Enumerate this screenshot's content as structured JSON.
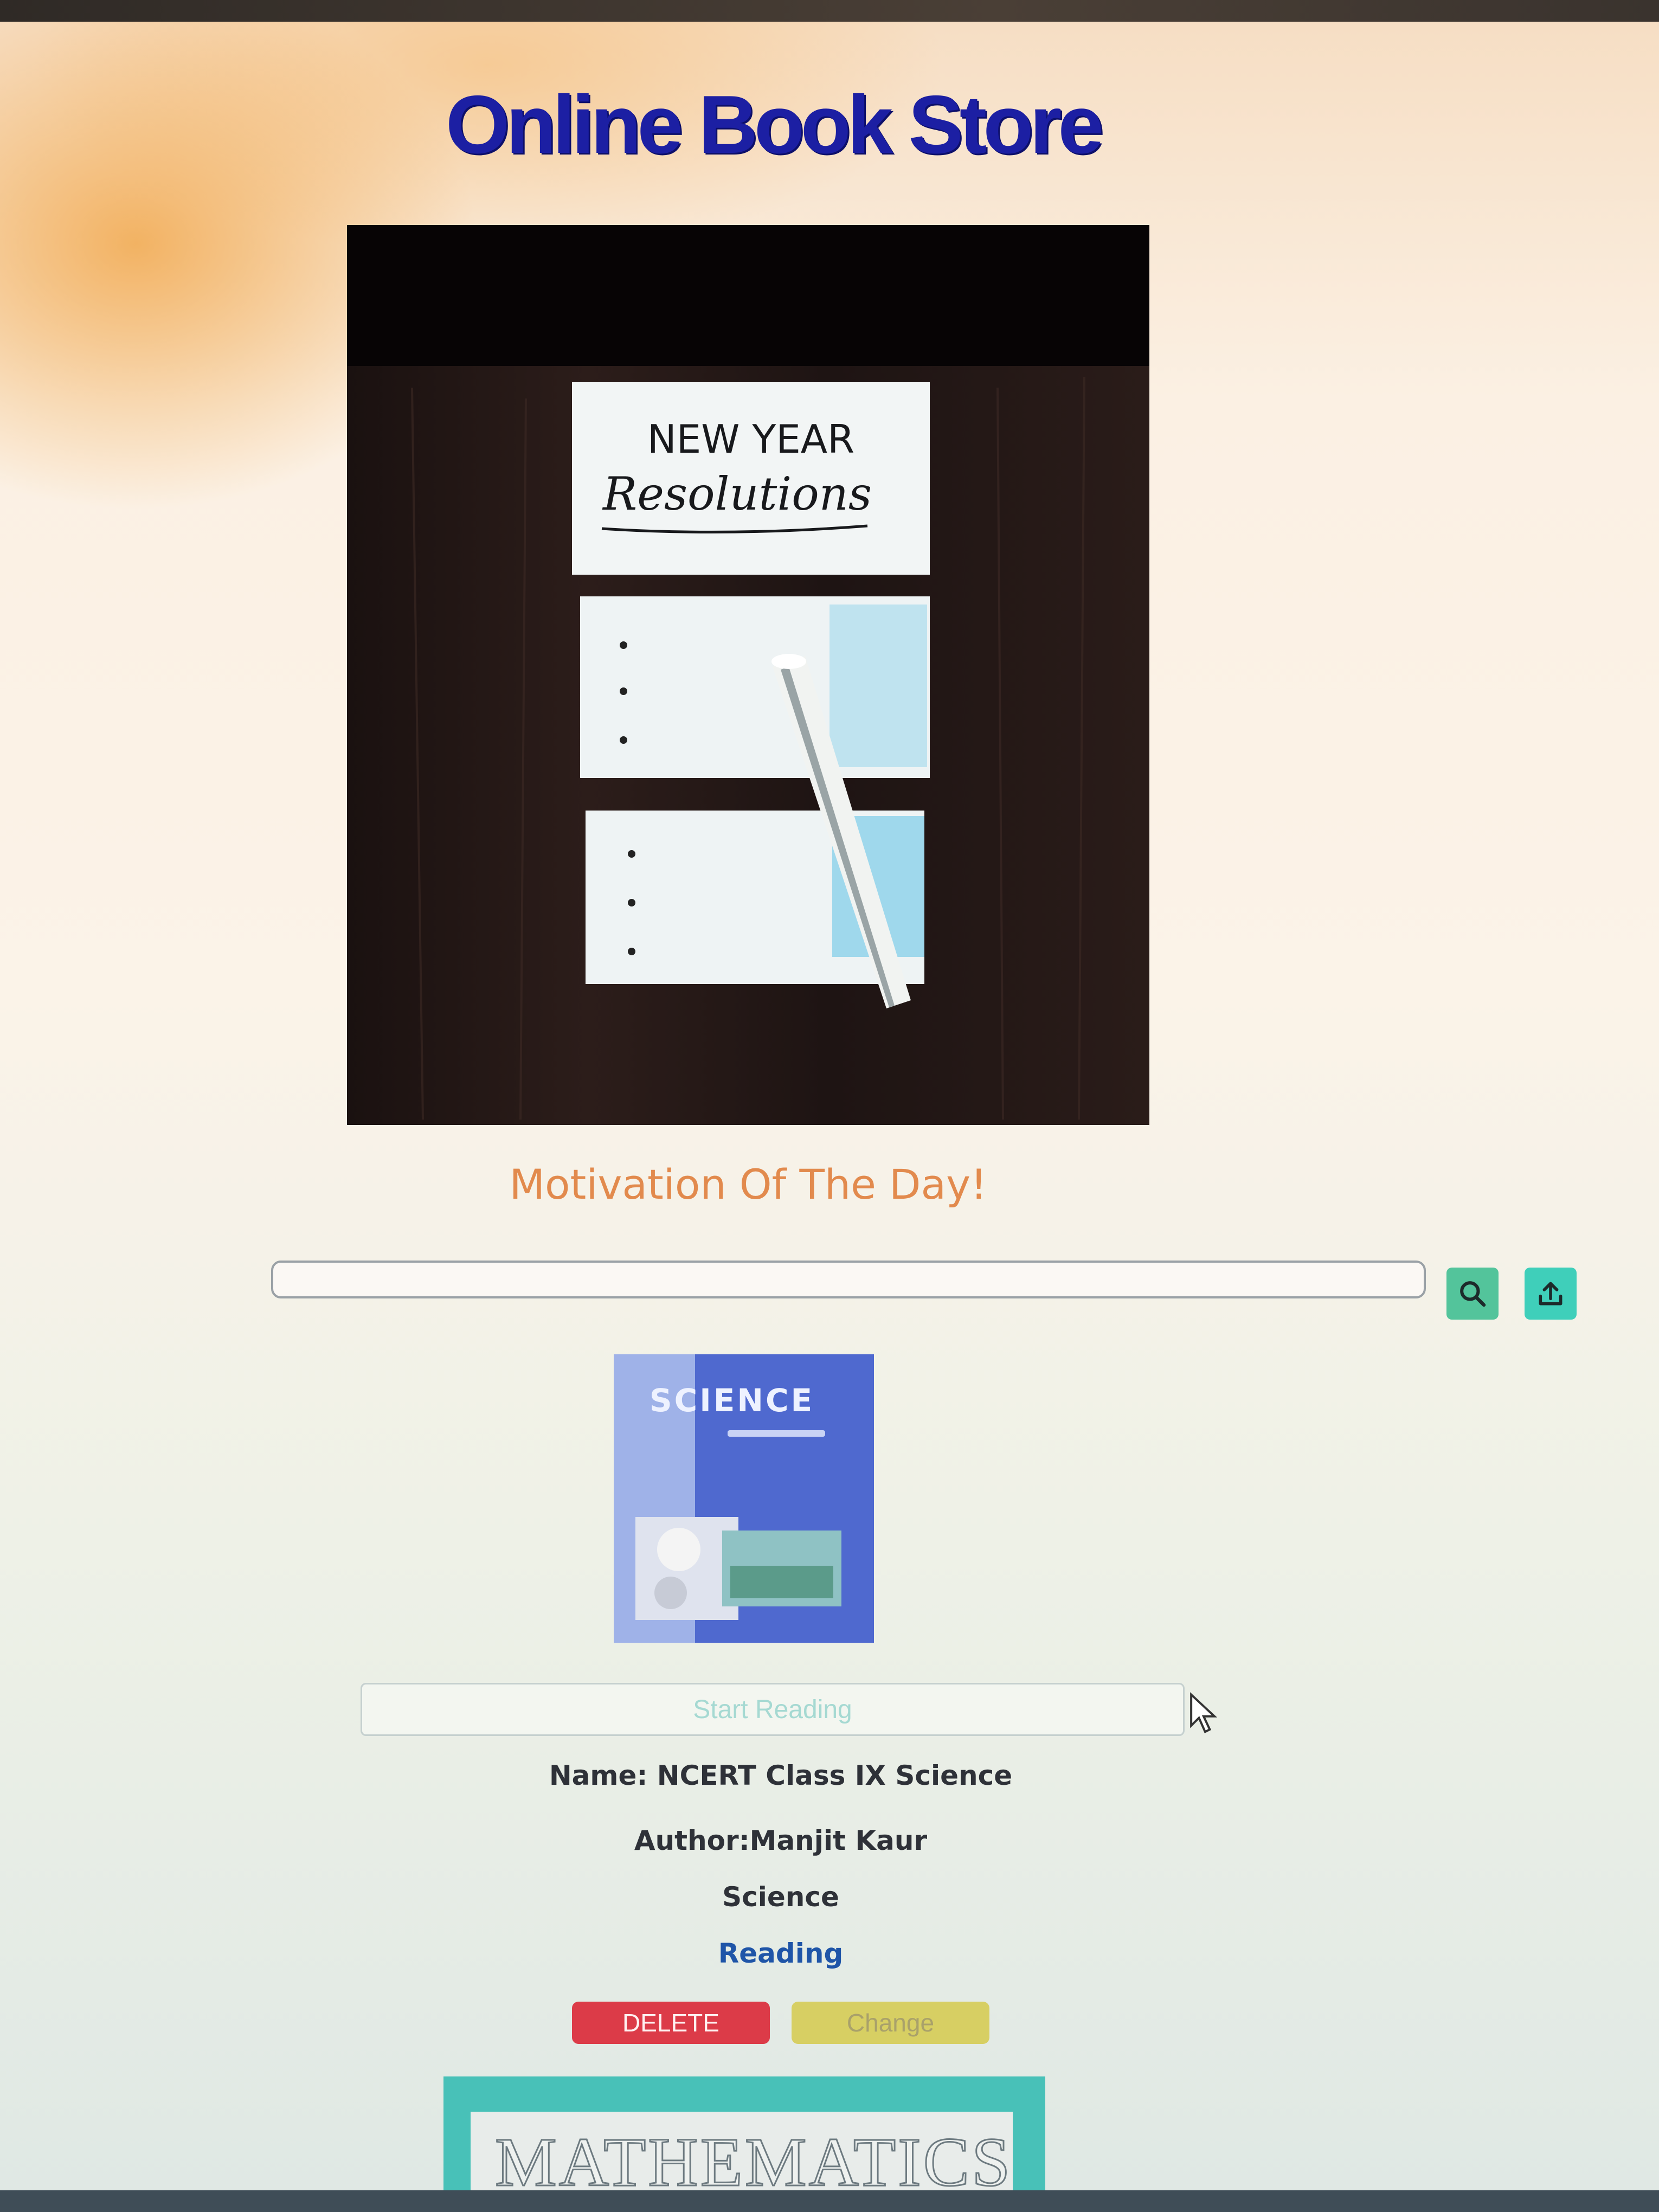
{
  "header": {
    "title": "Online Book Store",
    "icon": "book-icon",
    "title_color": "#1c1fa3"
  },
  "motivation": {
    "note_line1": "NEW YEAR",
    "note_line2": "Resolutions",
    "caption": "Motivation Of The Day!",
    "caption_color": "#e28a4d"
  },
  "search": {
    "value": "",
    "placeholder": "",
    "search_icon": "search-icon",
    "upload_icon": "upload-icon",
    "search_button_color": "#53c49b",
    "upload_button_color": "#3fcfba"
  },
  "books": [
    {
      "cover_title": "SCIENCE",
      "start_label": "Start Reading",
      "name": "Name: NCERT Class IX Science",
      "author": "Author:Manjit Kaur",
      "category": "Science",
      "status": "Reading",
      "delete_label": "DELETE",
      "change_label": "Change",
      "delete_color": "#dc3b48",
      "change_color": "#d7cf63"
    },
    {
      "cover_title": "MATHEMATICS"
    }
  ]
}
